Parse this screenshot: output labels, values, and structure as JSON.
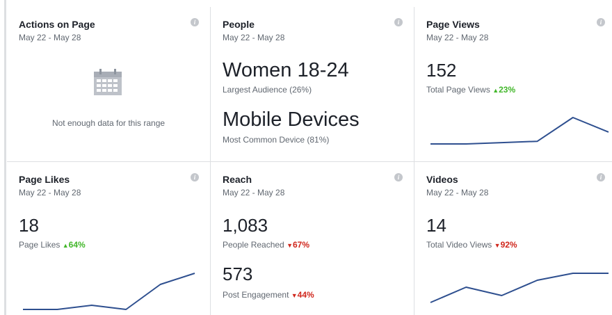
{
  "cards": {
    "actions": {
      "title": "Actions on Page",
      "date": "May 22 - May 28",
      "empty_message": "Not enough data for this range",
      "icon": "calendar-icon"
    },
    "people": {
      "title": "People",
      "date": "May 22 - May 28",
      "audience_value": "Women 18-24",
      "audience_label": "Largest Audience (26%)",
      "device_value": "Mobile Devices",
      "device_label": "Most Common Device (81%)"
    },
    "page_views": {
      "title": "Page Views",
      "date": "May 22 - May 28",
      "value": "152",
      "label": "Total Page Views",
      "delta": "23%",
      "delta_direction": "up",
      "trend": [
        0.0,
        0.0,
        0.1,
        0.2,
        2.0,
        0.9
      ]
    },
    "page_likes": {
      "title": "Page Likes",
      "date": "May 22 - May 28",
      "value": "18",
      "label": "Page Likes",
      "delta": "64%",
      "delta_direction": "up",
      "trend": [
        0.0,
        0.0,
        0.3,
        0.0,
        1.8,
        2.6
      ]
    },
    "reach": {
      "title": "Reach",
      "date": "May 22 - May 28",
      "value": "1,083",
      "label": "People Reached",
      "delta": "67%",
      "delta_direction": "down",
      "engagement_value": "573",
      "engagement_label": "Post Engagement",
      "engagement_delta": "44%",
      "engagement_delta_direction": "down"
    },
    "videos": {
      "title": "Videos",
      "date": "May 22 - May 28",
      "value": "14",
      "label": "Total Video Views",
      "delta": "92%",
      "delta_direction": "down",
      "trend": [
        0.0,
        1.1,
        0.5,
        1.6,
        2.1,
        2.1
      ]
    }
  },
  "glyphs": {
    "info": "i",
    "arrow_up": "▲",
    "arrow_down": "▼"
  },
  "colors": {
    "spark_line": "#2e4f8f",
    "positive": "#42b72a",
    "negative": "#d0271d",
    "border": "#dddfe2"
  }
}
